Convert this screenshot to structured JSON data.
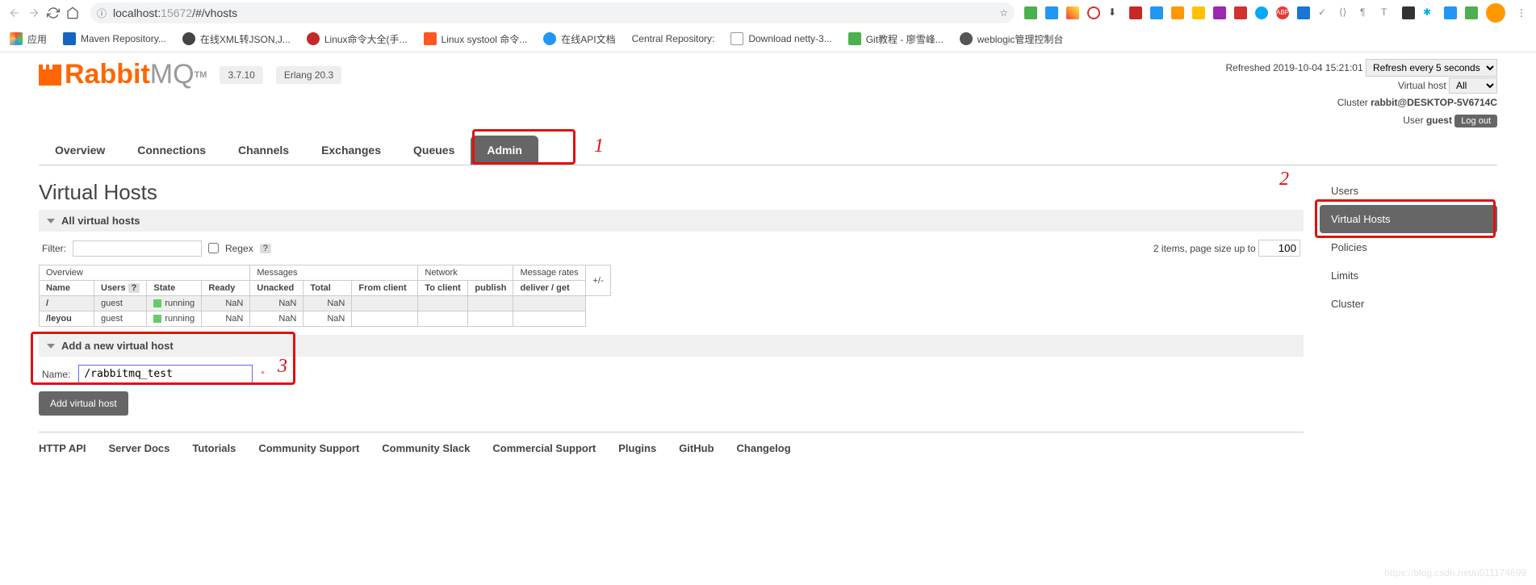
{
  "browser": {
    "url_host": "localhost:",
    "url_port": "15672",
    "url_path": "/#/vhosts",
    "bookmarks": [
      {
        "label": "应用"
      },
      {
        "label": "Maven Repository..."
      },
      {
        "label": "在线XML转JSON,J..."
      },
      {
        "label": "Linux命令大全(手..."
      },
      {
        "label": "Linux systool 命令..."
      },
      {
        "label": "在线API文档"
      },
      {
        "label": "Central Repository:"
      },
      {
        "label": "Download netty-3..."
      },
      {
        "label": "Git教程 - 廖雪峰..."
      },
      {
        "label": "weblogic管理控制台"
      }
    ]
  },
  "logo": {
    "main": "Rabbit",
    "sub": "MQ",
    "tm": "TM"
  },
  "versions": {
    "rabbit": "3.7.10",
    "erlang": "Erlang 20.3"
  },
  "status": {
    "refreshed": "Refreshed 2019-10-04 15:21:01",
    "refresh_select": "Refresh every 5 seconds",
    "vhost_label": "Virtual host",
    "vhost_value": "All",
    "cluster_label": "Cluster",
    "cluster_value": "rabbit@DESKTOP-5V6714C",
    "user_label": "User",
    "user_value": "guest",
    "logout": "Log out"
  },
  "nav": {
    "tabs": [
      "Overview",
      "Connections",
      "Channels",
      "Exchanges",
      "Queues",
      "Admin"
    ]
  },
  "annotations": {
    "n1": "1",
    "n2": "2",
    "n3": "3"
  },
  "page_title": "Virtual Hosts",
  "sections": {
    "all_vhosts": "All virtual hosts",
    "add_vhost": "Add a new virtual host"
  },
  "filter": {
    "label": "Filter:",
    "regex": "Regex",
    "items_text": "2 items, page size up to",
    "page_size": "100"
  },
  "table": {
    "group_headers": [
      "Overview",
      "Messages",
      "Network",
      "Message rates"
    ],
    "plus_minus": "+/-",
    "headers": {
      "name": "Name",
      "users": "Users",
      "q": "?",
      "state": "State",
      "ready": "Ready",
      "unacked": "Unacked",
      "total": "Total",
      "from_client": "From client",
      "to_client": "To client",
      "publish": "publish",
      "deliver_get": "deliver / get"
    },
    "rows": [
      {
        "name": "/",
        "users": "guest",
        "state": "running",
        "ready": "NaN",
        "unacked": "NaN",
        "total": "NaN"
      },
      {
        "name": "/leyou",
        "users": "guest",
        "state": "running",
        "ready": "NaN",
        "unacked": "NaN",
        "total": "NaN"
      }
    ]
  },
  "form": {
    "name_label": "Name:",
    "name_value": "/rabbitmq_test",
    "add_btn": "Add virtual host"
  },
  "sidebar": {
    "items": [
      "Users",
      "Virtual Hosts",
      "Policies",
      "Limits",
      "Cluster"
    ]
  },
  "footer": {
    "links": [
      "HTTP API",
      "Server Docs",
      "Tutorials",
      "Community Support",
      "Community Slack",
      "Commercial Support",
      "Plugins",
      "GitHub",
      "Changelog"
    ]
  },
  "watermark": "https://blog.csdn.net/u011174699"
}
